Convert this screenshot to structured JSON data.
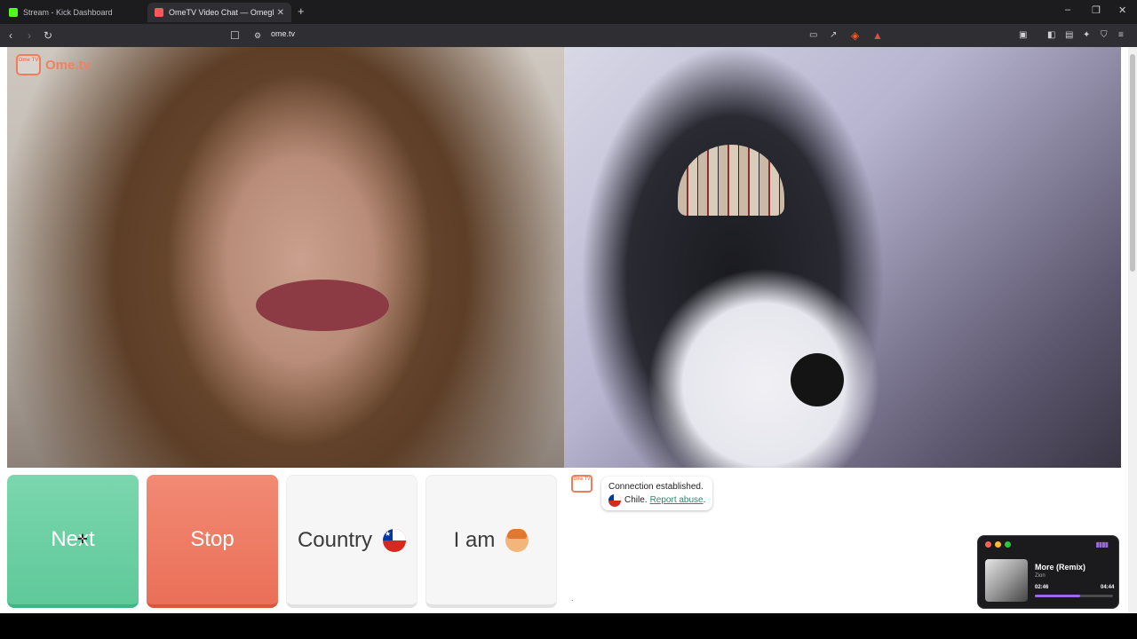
{
  "browser": {
    "tabs": [
      {
        "title": "Stream - Kick Dashboard",
        "favicon_color": "#53fc18"
      },
      {
        "title": "OmeTV Video Chat — Omegl",
        "favicon_color": "#ef5a5a"
      }
    ],
    "new_tab_symbol": "+",
    "url": "ome.tv",
    "window_controls": [
      "–",
      "❐",
      "✕"
    ]
  },
  "brand": {
    "name": "Ome.tv",
    "logo_text": "Ome TV"
  },
  "controls": {
    "next_label": "Next",
    "stop_label": "Stop",
    "country_label": "Country",
    "iam_label": "I am"
  },
  "chat": {
    "status_text": "Connection established.",
    "country_name": "Chile.",
    "report_link": "Report abuse",
    "report_suffix": ".",
    "input_value": "."
  },
  "music_player": {
    "song_title": "More (Remix)",
    "artist": "Zion",
    "elapsed": "02:46",
    "duration": "04:44",
    "progress": 0.585,
    "accent_color": "#a166e8"
  },
  "colors": {
    "next": "#5fc99a",
    "stop": "#ea6f58",
    "brand": "#f08262"
  }
}
